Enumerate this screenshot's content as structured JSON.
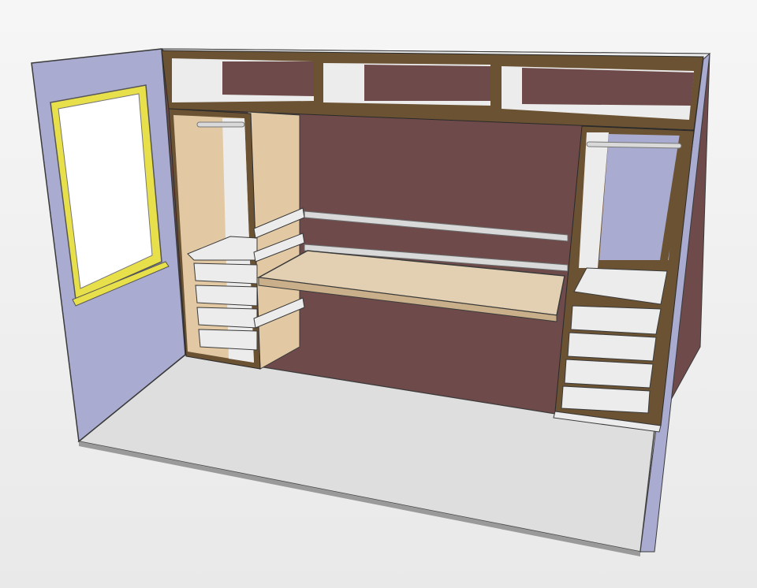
{
  "colors": {
    "background_top": "#f6f6f6",
    "background_bottom": "#e9e9e9",
    "side_wall": "#a9acd0",
    "back_wall": "#6e4b4a",
    "floor": "#dedede",
    "cabinet_frame": "#6a5233",
    "cabinet_panel": "#e2c9a4",
    "desk_top": "#e3d0b2",
    "white_panel": "#ececec",
    "window_frame": "#e8e04a",
    "window_glass": "#ffffff",
    "rail": "#d9d9d9",
    "outline": "#3a3a3a"
  }
}
